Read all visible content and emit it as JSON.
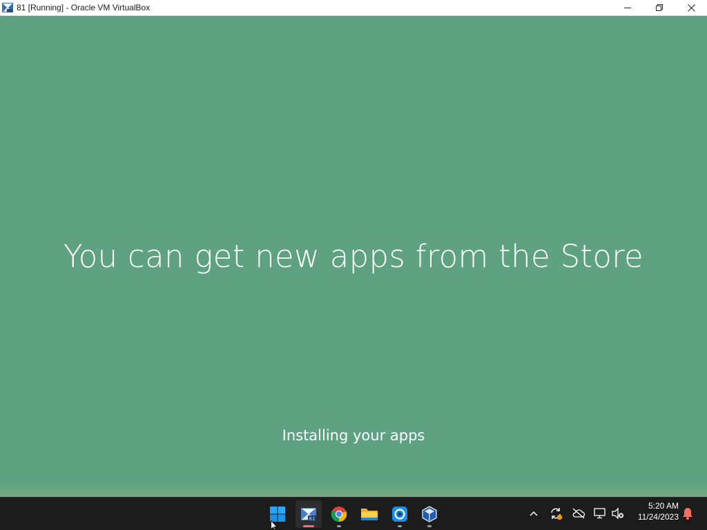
{
  "window": {
    "title": "81 [Running] - Oracle VM VirtualBox",
    "controls": {
      "minimize": "minimize",
      "restore": "restore",
      "close": "close"
    }
  },
  "guest_screen": {
    "headline": "You can get new apps from the Store",
    "status": "Installing your apps",
    "background_color": "#5ea281"
  },
  "taskbar": {
    "apps": [
      {
        "name": "start",
        "icon": "windows-logo-icon"
      },
      {
        "name": "virtualbox-vm",
        "icon": "virtualbox-vm-icon",
        "badge": "8.1",
        "focused": true
      },
      {
        "name": "chrome",
        "icon": "chrome-icon"
      },
      {
        "name": "file-explorer",
        "icon": "folder-icon"
      },
      {
        "name": "app-blue",
        "icon": "blue-app-icon"
      },
      {
        "name": "virtualbox-manager",
        "icon": "virtualbox-icon"
      }
    ],
    "tray": [
      "chevron-up-icon",
      "sync-icon",
      "cloud-off-icon",
      "network-icon",
      "volume-muted-icon",
      "notification-bell-icon"
    ],
    "clock": {
      "time": "5:20 AM",
      "date": "11/24/2023"
    }
  }
}
